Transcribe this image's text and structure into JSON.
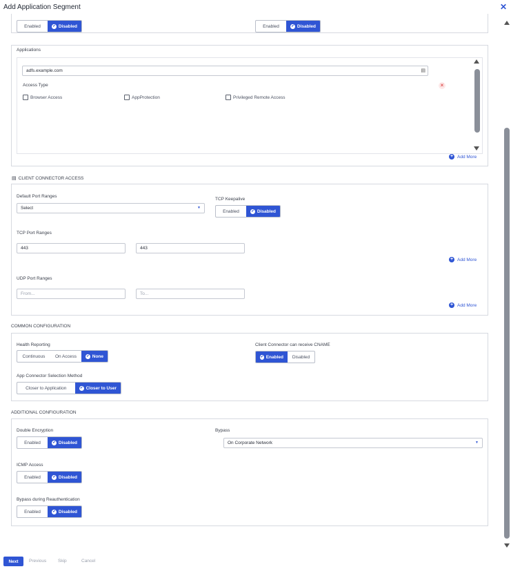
{
  "window": {
    "title": "Add Application Segment"
  },
  "top_toggles": [
    {
      "options": [
        "Enabled",
        "Disabled"
      ],
      "selected": "Disabled"
    },
    {
      "options": [
        "Enabled",
        "Disabled"
      ],
      "selected": "Disabled"
    }
  ],
  "applications": {
    "label": "Applications",
    "domain_value": "adfs.example.com",
    "access_type_label": "Access Type",
    "access_types": [
      "Browser Access",
      "AppProtection",
      "Privileged Remote Access"
    ],
    "remove_icon": "×",
    "add_more": "Add More"
  },
  "client_connector": {
    "heading": "CLIENT CONNECTOR ACCESS",
    "default_port_ranges_label": "Default Port Ranges",
    "default_port_ranges_value": "Select",
    "tcp_keepalive_label": "TCP Keepalive",
    "tcp_keepalive_options": [
      "Enabled",
      "Disabled"
    ],
    "tcp_keepalive_selected": "Disabled",
    "tcp_port_ranges_label": "TCP Port Ranges",
    "tcp_from": "443",
    "tcp_to": "443",
    "tcp_add_more": "Add More",
    "udp_port_ranges_label": "UDP Port Ranges",
    "udp_from_placeholder": "From...",
    "udp_to_placeholder": "To...",
    "udp_add_more": "Add More"
  },
  "common": {
    "heading": "COMMON CONFIGURATION",
    "health_reporting_label": "Health Reporting",
    "health_reporting_options": [
      "Continuous",
      "On Access",
      "None"
    ],
    "health_reporting_selected": "None",
    "cname_label": "Client Connector can receive CNAME",
    "cname_options": [
      "Enabled",
      "Disabled"
    ],
    "cname_selected": "Enabled",
    "selection_method_label": "App Connector Selection Method",
    "selection_method_options": [
      "Closer to Application",
      "Closer to User"
    ],
    "selection_method_selected": "Closer to User"
  },
  "additional": {
    "heading": "ADDITIONAL CONFIGURATION",
    "double_encryption_label": "Double Encryption",
    "double_encryption_options": [
      "Enabled",
      "Disabled"
    ],
    "double_encryption_selected": "Disabled",
    "bypass_label": "Bypass",
    "bypass_value": "On Corporate Network",
    "icmp_label": "ICMP Access",
    "icmp_options": [
      "Enabled",
      "Disabled"
    ],
    "icmp_selected": "Disabled",
    "bypass_reauth_label": "Bypass during Reauthentication",
    "bypass_reauth_options": [
      "Enabled",
      "Disabled"
    ],
    "bypass_reauth_selected": "Disabled"
  },
  "footer": {
    "next": "Next",
    "previous": "Previous",
    "skip": "Skip",
    "cancel": "Cancel"
  },
  "colors": {
    "accent": "#2f55d4",
    "border": "#d6d9e0",
    "remove_icon": "#e05555"
  },
  "icons": {
    "close": "close-icon",
    "server": "server-icon",
    "add": "plus-circle-icon",
    "remove": "remove-icon"
  }
}
